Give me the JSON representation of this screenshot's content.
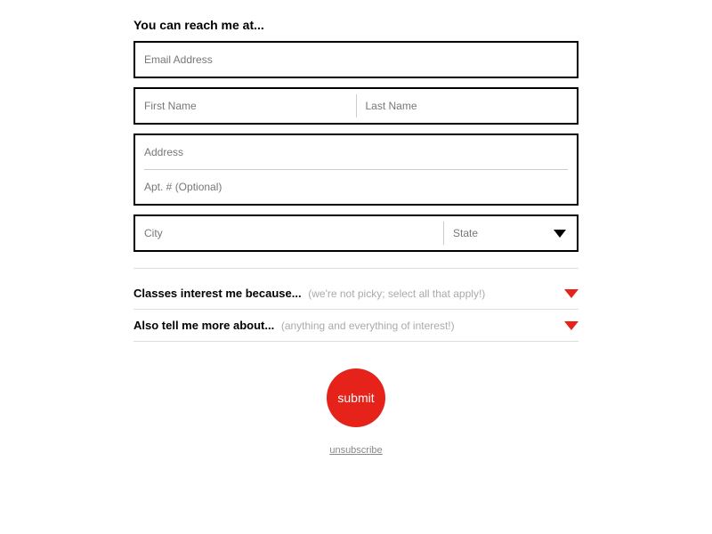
{
  "heading": "You can reach me at...",
  "fields": {
    "email_ph": "Email Address",
    "first_ph": "First Name",
    "last_ph": "Last Name",
    "address_ph": "Address",
    "apt_ph": "Apt. # (Optional)",
    "city_ph": "City",
    "state_ph": "State"
  },
  "accordion1": {
    "label": "Classes interest me because...",
    "hint": "(we're not picky; select all that apply!)"
  },
  "accordion2": {
    "label": "Also tell me more about...",
    "hint": "(anything and everything of interest!)"
  },
  "submit_label": "submit",
  "unsubscribe_label": "unsubscribe"
}
